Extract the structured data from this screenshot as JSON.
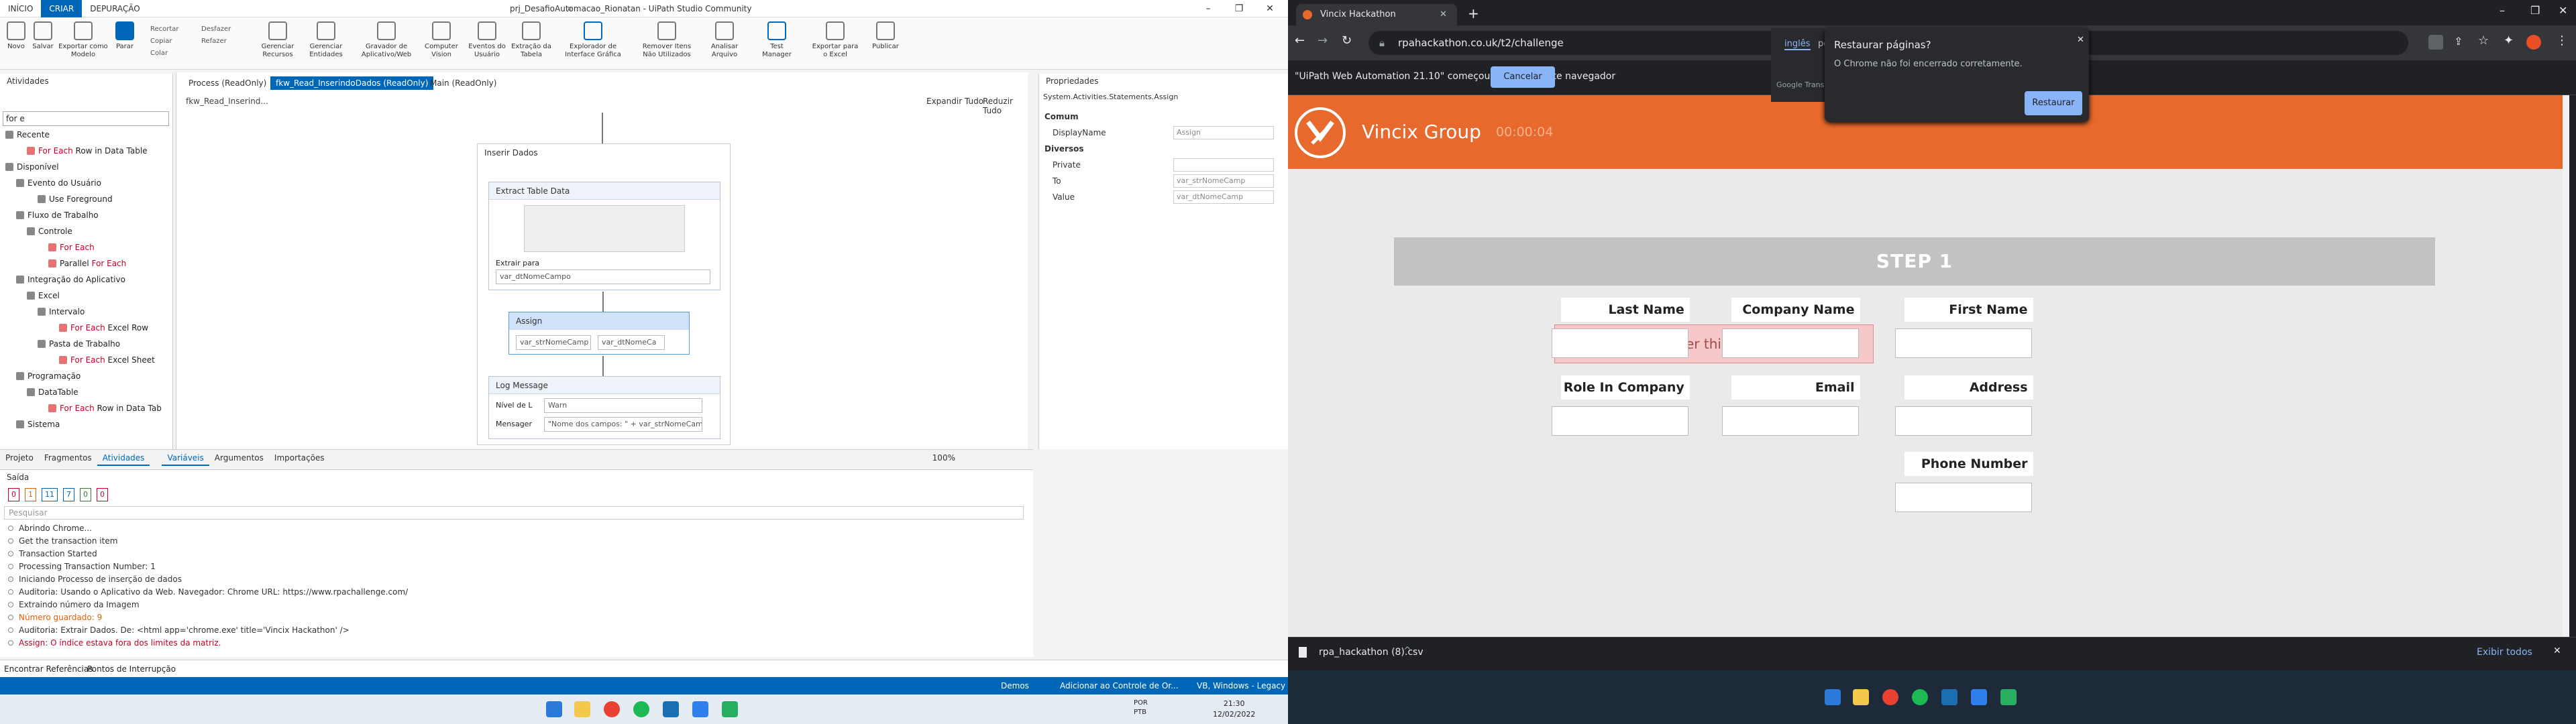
{
  "uipath": {
    "tabs": [
      "INÍCIO",
      "CRIAR",
      "DEPURAÇÃO"
    ],
    "window_title": "prj_DesafioAutomacao_Rionatan - UiPath Studio Community",
    "ribbon": {
      "new": "Novo",
      "save": "Salvar",
      "export_template": "Exportar como Modelo",
      "stop": "Parar",
      "cut": "Recortar",
      "copy": "Copiar",
      "paste": "Colar",
      "undo": "Desfazer",
      "redo": "Refazer",
      "manage_resources": "Gerenciar Recursos",
      "manage_entities": "Gerenciar Entidades",
      "recorder": "Gravador de Aplicativo/Web",
      "computer_vision": "Computer Vision",
      "user_events": "Eventos do Usuário",
      "table_extraction": "Extração da Tabela",
      "ui_explorer": "Explorador de Interface Gráfica",
      "remove_unused": "Remover Itens Não Utilizados",
      "analyze_file": "Analisar Arquivo",
      "test_manager": "Test Manager",
      "export_excel": "Exportar para o Excel",
      "publish": "Publicar"
    },
    "activities": {
      "title": "Atividades",
      "search": "for e",
      "items": [
        {
          "label": "Recente",
          "indent": 0
        },
        {
          "label_hl": "For Each",
          "label": " Row in Data Table",
          "indent": 2
        },
        {
          "label": "Disponível",
          "indent": 0
        },
        {
          "label": "Evento do Usuário",
          "indent": 1
        },
        {
          "label": "Use Foreground",
          "indent": 3
        },
        {
          "label": "Fluxo de Trabalho",
          "indent": 1
        },
        {
          "label": "Controle",
          "indent": 2
        },
        {
          "label_hl": "For Each",
          "label": "",
          "indent": 4
        },
        {
          "label": "Parallel ",
          "label_hl": "For Each",
          "indent": 4
        },
        {
          "label": "Integração do Aplicativo",
          "indent": 1
        },
        {
          "label": "Excel",
          "indent": 2
        },
        {
          "label": "Intervalo",
          "indent": 3
        },
        {
          "label_hl": "For Each",
          "label": " Excel Row",
          "indent": 5
        },
        {
          "label": "Pasta de Trabalho",
          "indent": 3
        },
        {
          "label_hl": "For Each",
          "label": " Excel Sheet",
          "indent": 5
        },
        {
          "label": "Programação",
          "indent": 1
        },
        {
          "label": "DataTable",
          "indent": 2
        },
        {
          "label_hl": "For Each",
          "label": " Row in Data Tab",
          "indent": 4
        },
        {
          "label": "Sistema",
          "indent": 1
        }
      ],
      "bottom_tabs": [
        "Projeto",
        "Fragmentos",
        "Atividades"
      ]
    },
    "designer": {
      "tabs": [
        "Process (ReadOnly)",
        "fkw_Read_InserindoDados (ReadOnly)",
        "Main (ReadOnly)"
      ],
      "breadcrumb": "fkw_Read_Inserind...",
      "expand_all": "Expandir Tudo",
      "collapse_all": "Reduzir Tudo",
      "sequence": "Inserir Dados",
      "extract": {
        "title": "Extract Table Data",
        "extract_to_label": "Extrair para",
        "extract_to": "var_dtNomeCampo"
      },
      "assign": {
        "title": "Assign",
        "to": "var_strNomeCamp",
        "value": "var_dtNomeCa"
      },
      "log": {
        "title": "Log Message",
        "level_label": "Nível de L",
        "level": "Warn",
        "message_label": "Mensager",
        "message": "\"Nome dos campos: \" + var_strNomeCamp"
      },
      "bottom_tabs": [
        "Variáveis",
        "Argumentos",
        "Importações"
      ],
      "zoom": "100%"
    },
    "properties": {
      "title": "Propriedades",
      "type": "System.Activities.Statements.Assign",
      "sections": [
        {
          "label": "Comum",
          "header": true
        },
        {
          "label": "DisplayName",
          "value": "Assign"
        },
        {
          "label": "Diversos",
          "header": true
        },
        {
          "label": "Private",
          "value": ""
        },
        {
          "label": "To",
          "value": "var_strNomeCamp"
        },
        {
          "label": "Value",
          "value": "var_dtNomeCamp"
        }
      ]
    },
    "output": {
      "title": "Saída",
      "search": "Pesquisar",
      "filters": [
        "0",
        "1",
        "11",
        "7",
        "0",
        "0"
      ],
      "lines": [
        {
          "text": "Abrindo Chrome...",
          "type": "info"
        },
        {
          "text": "Get the transaction item",
          "type": "info"
        },
        {
          "text": "Transaction Started",
          "type": "info"
        },
        {
          "text": "Processing Transaction Number: 1",
          "type": "info"
        },
        {
          "text": "Iniciando Processo de inserção de dados",
          "type": "info"
        },
        {
          "text": "Auditoria: Usando o Aplicativo da Web. Navegador: Chrome URL: https://www.rpachallenge.com/ ",
          "type": "info"
        },
        {
          "text": "Extraindo número da Imagem",
          "type": "info"
        },
        {
          "text": "Número guardado: 9",
          "type": "warn"
        },
        {
          "text": "Auditoria: Extrair Dados. De: <html app='chrome.exe' title='Vincix Hackathon' />",
          "type": "info"
        },
        {
          "text": "Assign: O índice estava fora dos limites da matriz.",
          "type": "err"
        }
      ]
    },
    "status": {
      "find_refs": "Encontrar Referências",
      "breakpoints": "Pontos de Interrupção",
      "demos": "Demos",
      "source_control": "Adicionar ao Controle de Or...",
      "version": "VB, Windows - Legacy"
    },
    "taskbar": {
      "lang": "POR",
      "kbd": "PTB",
      "time": "21:30",
      "date": "12/02/2022"
    }
  },
  "chrome": {
    "tab_title": "Vincix Hackathon",
    "url": "rpahackathon.co.uk/t2/challenge",
    "info_bar": "\"UiPath Web Automation 21.10\" começou a depurar este navegador",
    "cancel": "Cancelar",
    "translate": {
      "lang": "inglês",
      "lang2": "por",
      "google": "Google Translate"
    },
    "restore": {
      "title": "Restaurar páginas?",
      "body": "O Chrome não foi encerrado corretamente.",
      "button": "Restaurar"
    },
    "page": {
      "brand": "Vincix Group",
      "timer": "00:00:04",
      "step": "STEP 1",
      "remember": "Remember this number: 9",
      "fields": [
        "Last Name",
        "Company Name",
        "First Name",
        "Role In Company",
        "Email",
        "Address",
        "Phone Number"
      ]
    },
    "download": {
      "file": "rpa_hackathon (8).csv",
      "show_all": "Exibir todos"
    },
    "accent": "#e8692d"
  }
}
